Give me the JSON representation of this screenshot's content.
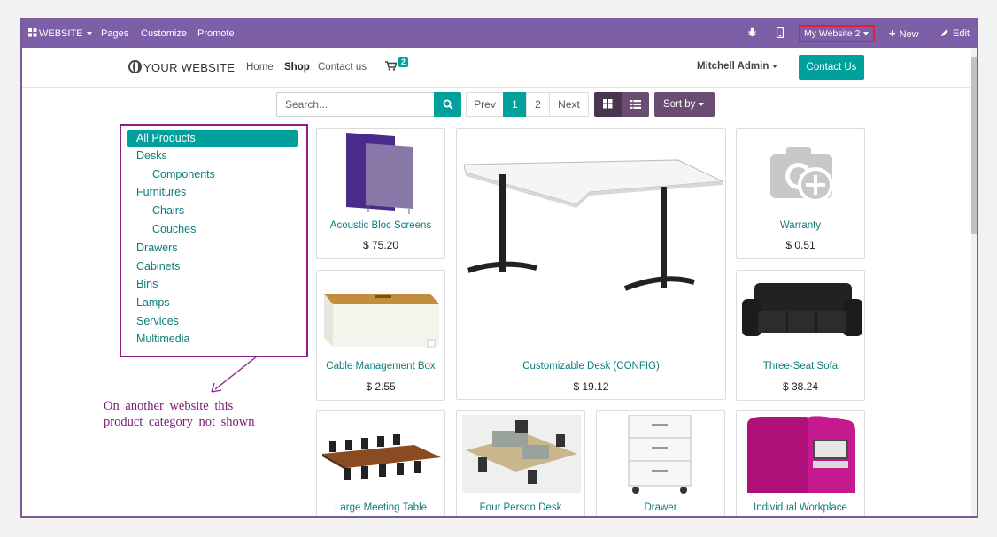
{
  "adminbar": {
    "website_menu": "WEBSITE",
    "pages": "Pages",
    "customize": "Customize",
    "promote": "Promote",
    "website_switcher": "My Website 2",
    "new": "New",
    "edit": "Edit"
  },
  "header": {
    "logo": "YOUR WEBSITE",
    "nav": [
      "Home",
      "Shop",
      "Contact us"
    ],
    "cart_count": "2",
    "user": "Mitchell Admin",
    "contact_button": "Contact Us"
  },
  "toolbar": {
    "search_placeholder": "Search...",
    "prev": "Prev",
    "pages": [
      "1",
      "2"
    ],
    "current_page": "1",
    "next": "Next",
    "sort_by": "Sort by"
  },
  "categories": [
    {
      "label": "All Products",
      "selected": true,
      "level": 0
    },
    {
      "label": "Desks",
      "level": 0
    },
    {
      "label": "Components",
      "level": 1
    },
    {
      "label": "Furnitures",
      "level": 0
    },
    {
      "label": "Chairs",
      "level": 1
    },
    {
      "label": "Couches",
      "level": 1
    },
    {
      "label": "Drawers",
      "level": 0
    },
    {
      "label": "Cabinets",
      "level": 0
    },
    {
      "label": "Bins",
      "level": 0
    },
    {
      "label": "Lamps",
      "level": 0
    },
    {
      "label": "Services",
      "level": 0
    },
    {
      "label": "Multimedia",
      "level": 0
    }
  ],
  "annotation": {
    "line1": "On another website this",
    "line2": "product category not shown"
  },
  "products": [
    {
      "name": "Acoustic Bloc Screens",
      "price": "$ 75.20"
    },
    {
      "name": "Customizable Desk (CONFIG)",
      "price": "$ 19.12"
    },
    {
      "name": "Warranty",
      "price": "$ 0.51"
    },
    {
      "name": "Cable Management Box",
      "price": "$ 2.55"
    },
    {
      "name": "Three-Seat Sofa",
      "price": "$ 38.24"
    },
    {
      "name": "Large Meeting Table",
      "price": ""
    },
    {
      "name": "Four Person Desk",
      "price": ""
    },
    {
      "name": "Drawer",
      "price": ""
    },
    {
      "name": "Individual Workplace",
      "price": ""
    }
  ],
  "colors": {
    "adminbar": "#7c5fa6",
    "primary": "#00a09d",
    "sort_button": "#6b4d71",
    "annotation": "#8a1f8a"
  }
}
